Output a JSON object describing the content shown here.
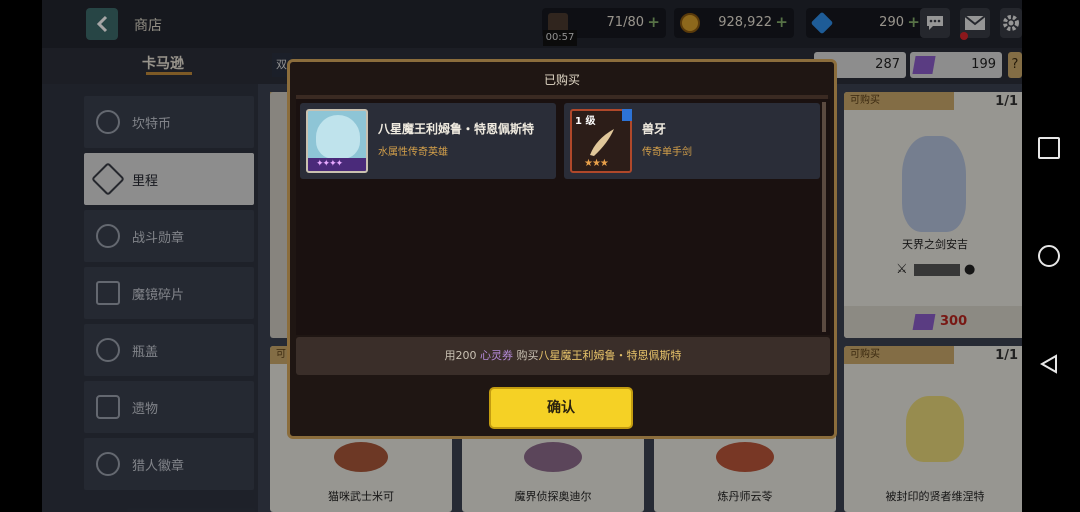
{
  "header": {
    "title": "商店",
    "stamina": {
      "value": "71/80",
      "timer": "00:57"
    },
    "gold": "928,922",
    "gems": "290",
    "plus": "+"
  },
  "tabs": {
    "active": "卡马逊",
    "partial_left": "双",
    "currency_a": "287",
    "currency_b": "199",
    "help": "?"
  },
  "sidebar": {
    "items": [
      {
        "label": "坎特币",
        "active": false
      },
      {
        "label": "里程",
        "active": true
      },
      {
        "label": "战斗勋章",
        "active": false
      },
      {
        "label": "魔镜碎片",
        "active": false
      },
      {
        "label": "瓶盖",
        "active": false
      },
      {
        "label": "遗物",
        "active": false
      },
      {
        "label": "猎人徽章",
        "active": false
      }
    ]
  },
  "shop": {
    "cards": [
      {
        "tag": "可购买",
        "count": "1/1",
        "name": "天界之剑安吉",
        "price": "300"
      },
      {
        "tag": "可购买",
        "count": "1/1",
        "name": "被封印的贤者维涅特",
        "price": ""
      },
      {
        "tag": "可",
        "count": "",
        "name": "猫咪武士米可",
        "price": ""
      },
      {
        "tag": "",
        "count": "",
        "name": "魔界侦探奥迪尔",
        "price": ""
      },
      {
        "tag": "",
        "count": "",
        "name": "炼丹师云苓",
        "price": ""
      }
    ],
    "partial_tag_top": "双"
  },
  "dialog": {
    "title": "已购买",
    "items": [
      {
        "name": "八星魔王利姆鲁・特恩佩斯特",
        "subtitle": "水属性传奇英雄",
        "stars": "✦✦✦✦"
      },
      {
        "name": "兽牙",
        "subtitle": "传奇单手剑",
        "level": "1 级",
        "stars": "★★★"
      }
    ],
    "purchase_text": {
      "prefix": "用200",
      "currency": "心灵券",
      "middle": "购买",
      "target": "八星魔王利姆鲁・特恩佩斯特"
    },
    "confirm_label": "确认"
  },
  "colors": {
    "accent_gold": "#f5d125",
    "dialog_border": "#8b6d3c",
    "price_red": "#b8261f"
  }
}
